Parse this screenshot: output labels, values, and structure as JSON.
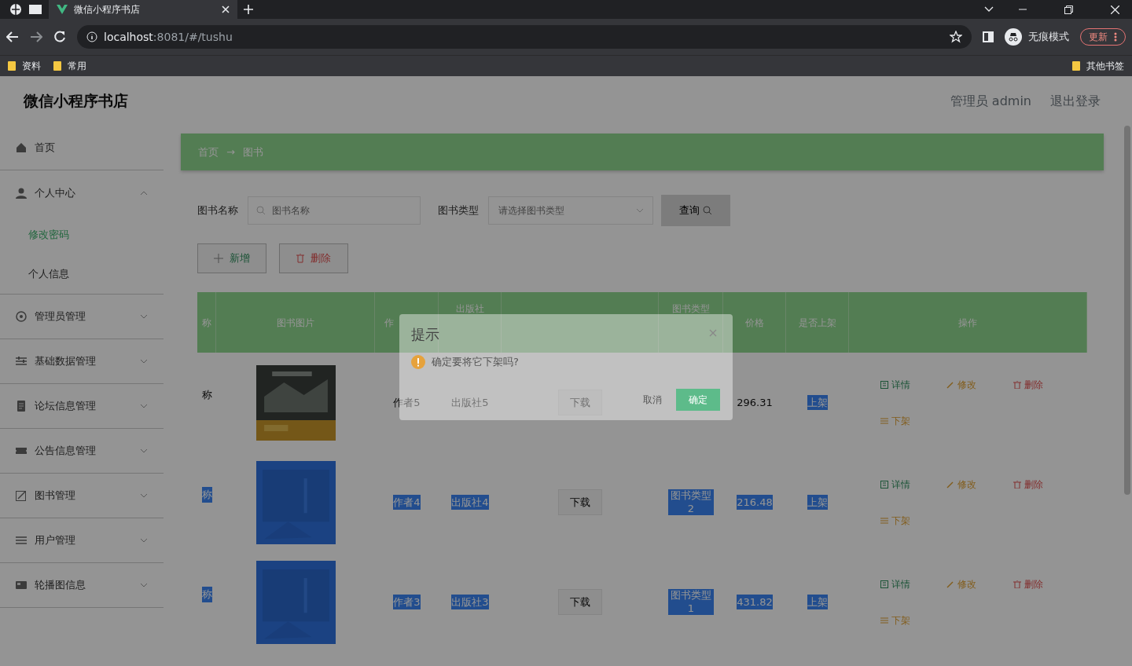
{
  "browser": {
    "tabs": [
      {
        "title": "微信小程序书店",
        "selected": true
      }
    ],
    "url_host": "localhost",
    "url_rest": ":8081/#/tushu",
    "profile": "无痕模式",
    "update_button": "更新",
    "bookmarks": [
      {
        "label": "资料"
      },
      {
        "label": "常用"
      }
    ],
    "other_bookmarks": "其他书签"
  },
  "app": {
    "title": "微信小程序书店",
    "user": "管理员 admin",
    "logout": "退出登录"
  },
  "sidebar": {
    "items": [
      {
        "label": "首页"
      },
      {
        "label": "个人中心",
        "expanded": true,
        "children": [
          {
            "label": "修改密码",
            "selected": true
          },
          {
            "label": "个人信息",
            "selected": false
          }
        ]
      },
      {
        "label": "管理员管理",
        "expanded": false
      },
      {
        "label": "基础数据管理",
        "expanded": false
      },
      {
        "label": "论坛信息管理",
        "expanded": false
      },
      {
        "label": "公告信息管理",
        "expanded": false
      },
      {
        "label": "图书管理",
        "expanded": false
      },
      {
        "label": "用户管理",
        "expanded": false
      },
      {
        "label": "轮播图信息",
        "expanded": false
      }
    ]
  },
  "breadcrumb": {
    "items": [
      "首页",
      "图书"
    ],
    "separator": "→"
  },
  "search": {
    "fields": [
      {
        "label": "图书名称",
        "placeholder": "图书名称",
        "kind": "text"
      },
      {
        "label": "图书类型",
        "placeholder": "请选择图书类型",
        "kind": "select"
      }
    ],
    "button": "查询"
  },
  "actions": [
    {
      "label": "新增",
      "kind": "add"
    },
    {
      "label": "删除",
      "kind": "delete"
    }
  ],
  "table": {
    "columns": [
      {
        "label": "称"
      },
      {
        "label": "图书图片"
      },
      {
        "label": "作"
      },
      {
        "label": "出版社"
      },
      {},
      {
        "label": "图书类型"
      },
      {
        "label": "价格"
      },
      {
        "label": "是否上架"
      },
      {
        "label": "操作"
      }
    ],
    "rows": [
      {
        "cells": [
          {
            "kind": "text",
            "text": "称",
            "highlighted": false
          },
          {
            "kind": "picture",
            "highlighted": false
          },
          {
            "kind": "text",
            "text": "作者5",
            "highlighted": false
          },
          {
            "kind": "text",
            "text": "出版社5",
            "highlighted": false
          },
          {
            "kind": "button",
            "text": "下载"
          },
          {
            "kind": "empty"
          },
          {
            "kind": "text",
            "text": "296.31",
            "highlighted": false
          },
          {
            "kind": "text",
            "text": "上架",
            "highlighted": true
          },
          {
            "kind": "actions",
            "actions": [
              {
                "label": "详情",
                "kind": "detail"
              },
              {
                "label": "修改",
                "kind": "edit"
              },
              {
                "label": "删除",
                "kind": "delete"
              },
              {
                "label": "下架",
                "kind": "off"
              }
            ]
          }
        ]
      },
      {
        "cells": [
          {
            "kind": "text",
            "text": "称",
            "highlighted": true
          },
          {
            "kind": "picture",
            "highlighted": true
          },
          {
            "kind": "text",
            "text": "作者4",
            "highlighted": true
          },
          {
            "kind": "text",
            "text": "出版社4",
            "highlighted": true
          },
          {
            "kind": "button",
            "text": "下载"
          },
          {
            "kind": "text",
            "text": "图书类型2",
            "highlighted": true
          },
          {
            "kind": "text",
            "text": "216.48",
            "highlighted": true
          },
          {
            "kind": "text",
            "text": "上架",
            "highlighted": true
          },
          {
            "kind": "actions",
            "actions": [
              {
                "label": "详情",
                "kind": "detail"
              },
              {
                "label": "修改",
                "kind": "edit"
              },
              {
                "label": "删除",
                "kind": "delete"
              },
              {
                "label": "下架",
                "kind": "off"
              }
            ]
          }
        ]
      },
      {
        "cells": [
          {
            "kind": "text",
            "text": "称",
            "highlighted": true
          },
          {
            "kind": "picture",
            "highlighted": true
          },
          {
            "kind": "text",
            "text": "作者3",
            "highlighted": true
          },
          {
            "kind": "text",
            "text": "出版社3",
            "highlighted": true
          },
          {
            "kind": "button",
            "text": "下载"
          },
          {
            "kind": "text",
            "text": "图书类型1",
            "highlighted": true
          },
          {
            "kind": "text",
            "text": "431.82",
            "highlighted": true
          },
          {
            "kind": "text",
            "text": "上架",
            "highlighted": true
          },
          {
            "kind": "actions",
            "actions": [
              {
                "label": "详情",
                "kind": "detail"
              },
              {
                "label": "修改",
                "kind": "edit"
              },
              {
                "label": "删除",
                "kind": "delete"
              },
              {
                "label": "下架",
                "kind": "off"
              }
            ]
          }
        ]
      }
    ]
  },
  "dialog": {
    "title": "提示",
    "message": "确定要将它下架吗?",
    "cancel": "取消",
    "confirm": "确定"
  }
}
